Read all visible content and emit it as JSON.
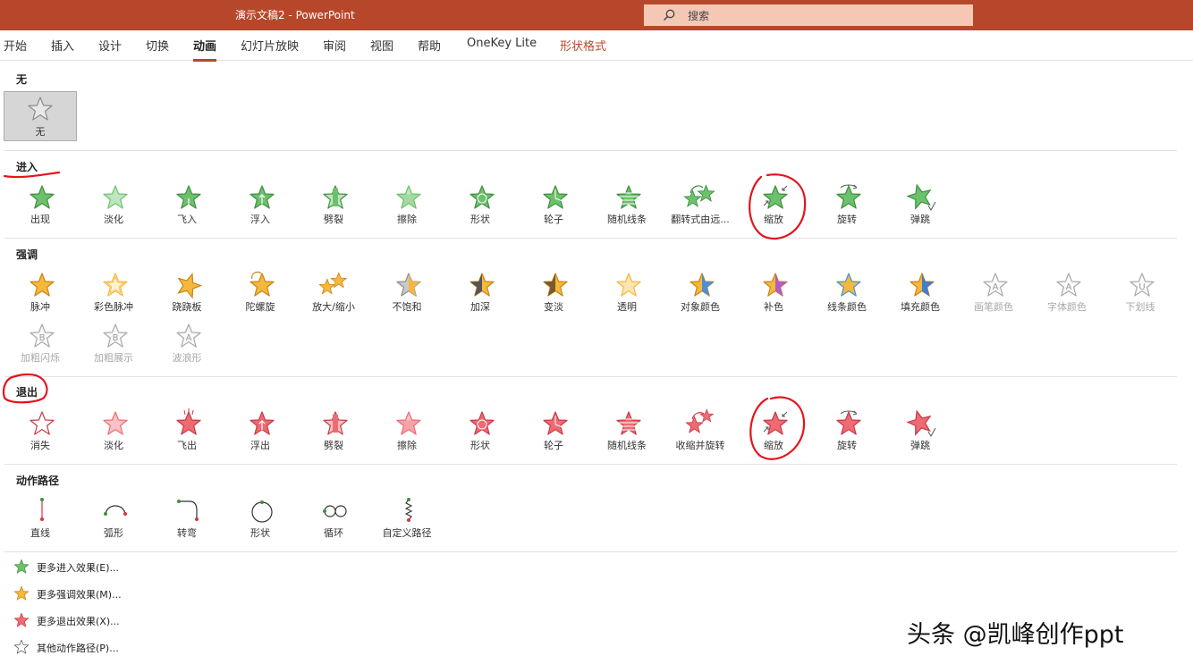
{
  "titlebar": {
    "doc_title": "演示文稿2  -  PowerPoint",
    "search_placeholder": "搜索",
    "color": "#b7472a"
  },
  "tabs": [
    "开始",
    "插入",
    "设计",
    "切换",
    "动画",
    "幻灯片放映",
    "审阅",
    "视图",
    "帮助",
    "OneKey Lite",
    "形状格式"
  ],
  "active_tab": "动画",
  "sections": {
    "none": {
      "title": "无",
      "items": [
        {
          "label": "无",
          "icon": "empty-star-icon"
        }
      ]
    },
    "entrance": {
      "title": "进入",
      "color": "#5cb85c",
      "items": [
        {
          "label": "出现",
          "icon": "star-icon"
        },
        {
          "label": "淡化",
          "icon": "star-fade-icon"
        },
        {
          "label": "飞入",
          "icon": "star-fly-icon"
        },
        {
          "label": "浮入",
          "icon": "star-float-icon"
        },
        {
          "label": "劈裂",
          "icon": "star-split-icon"
        },
        {
          "label": "擦除",
          "icon": "star-wipe-icon"
        },
        {
          "label": "形状",
          "icon": "star-shape-icon"
        },
        {
          "label": "轮子",
          "icon": "star-wheel-icon"
        },
        {
          "label": "随机线条",
          "icon": "star-lines-icon"
        },
        {
          "label": "翻转式由远...",
          "icon": "star-grow-turn-icon"
        },
        {
          "label": "缩放",
          "icon": "star-zoom-icon"
        },
        {
          "label": "旋转",
          "icon": "star-swivel-icon"
        },
        {
          "label": "弹跳",
          "icon": "star-bounce-icon"
        }
      ]
    },
    "emphasis": {
      "title": "强调",
      "color": "#f4b43c",
      "items": [
        {
          "label": "脉冲",
          "icon": "star-pulse-icon"
        },
        {
          "label": "彩色脉冲",
          "icon": "star-color-pulse-icon"
        },
        {
          "label": "跷跷板",
          "icon": "star-teeter-icon"
        },
        {
          "label": "陀螺旋",
          "icon": "star-spin-icon"
        },
        {
          "label": "放大/缩小",
          "icon": "star-grow-shrink-icon"
        },
        {
          "label": "不饱和",
          "icon": "star-desaturate-icon"
        },
        {
          "label": "加深",
          "icon": "star-darken-icon"
        },
        {
          "label": "变淡",
          "icon": "star-lighten-icon"
        },
        {
          "label": "透明",
          "icon": "star-transparency-icon"
        },
        {
          "label": "对象颜色",
          "icon": "star-object-color-icon"
        },
        {
          "label": "补色",
          "icon": "star-complementary-icon"
        },
        {
          "label": "线条颜色",
          "icon": "star-line-color-icon"
        },
        {
          "label": "填充颜色",
          "icon": "star-fill-color-icon"
        },
        {
          "label": "画笔颜色",
          "icon": "star-brush-color-icon",
          "disabled": true
        },
        {
          "label": "字体颜色",
          "icon": "star-font-color-icon",
          "disabled": true
        },
        {
          "label": "下划线",
          "icon": "star-underline-icon",
          "disabled": true
        },
        {
          "label": "加粗闪烁",
          "icon": "star-bold-flash-icon",
          "disabled": true
        },
        {
          "label": "加粗展示",
          "icon": "star-bold-reveal-icon",
          "disabled": true
        },
        {
          "label": "波浪形",
          "icon": "star-wave-icon",
          "disabled": true
        }
      ]
    },
    "exit": {
      "title": "退出",
      "color": "#e8505b",
      "items": [
        {
          "label": "消失",
          "icon": "star-outline-icon"
        },
        {
          "label": "淡化",
          "icon": "star-fade-icon"
        },
        {
          "label": "飞出",
          "icon": "star-fly-icon"
        },
        {
          "label": "浮出",
          "icon": "star-float-icon"
        },
        {
          "label": "劈裂",
          "icon": "star-split-icon"
        },
        {
          "label": "擦除",
          "icon": "star-wipe-icon"
        },
        {
          "label": "形状",
          "icon": "star-shape-icon"
        },
        {
          "label": "轮子",
          "icon": "star-wheel-icon"
        },
        {
          "label": "随机线条",
          "icon": "star-lines-icon"
        },
        {
          "label": "收缩并旋转",
          "icon": "star-shrink-turn-icon"
        },
        {
          "label": "缩放",
          "icon": "star-zoom-icon"
        },
        {
          "label": "旋转",
          "icon": "star-swivel-icon"
        },
        {
          "label": "弹跳",
          "icon": "star-bounce-icon"
        }
      ]
    },
    "paths": {
      "title": "动作路径",
      "items": [
        {
          "label": "直线",
          "icon": "line-path-icon"
        },
        {
          "label": "弧形",
          "icon": "arc-path-icon"
        },
        {
          "label": "转弯",
          "icon": "turn-path-icon"
        },
        {
          "label": "形状",
          "icon": "circle-path-icon"
        },
        {
          "label": "循环",
          "icon": "loop-path-icon"
        },
        {
          "label": "自定义路径",
          "icon": "custom-path-icon"
        }
      ]
    }
  },
  "more_effects": [
    {
      "label": "更多进入效果(E)...",
      "icon": "green-star-icon"
    },
    {
      "label": "更多强调效果(M)...",
      "icon": "orange-star-icon"
    },
    {
      "label": "更多退出效果(X)...",
      "icon": "red-star-icon"
    },
    {
      "label": "其他动作路径(P)...",
      "icon": "outline-star-icon"
    }
  ],
  "watermark": "头条 @凯峰创作ppt",
  "annotation_color": "#e3141c"
}
